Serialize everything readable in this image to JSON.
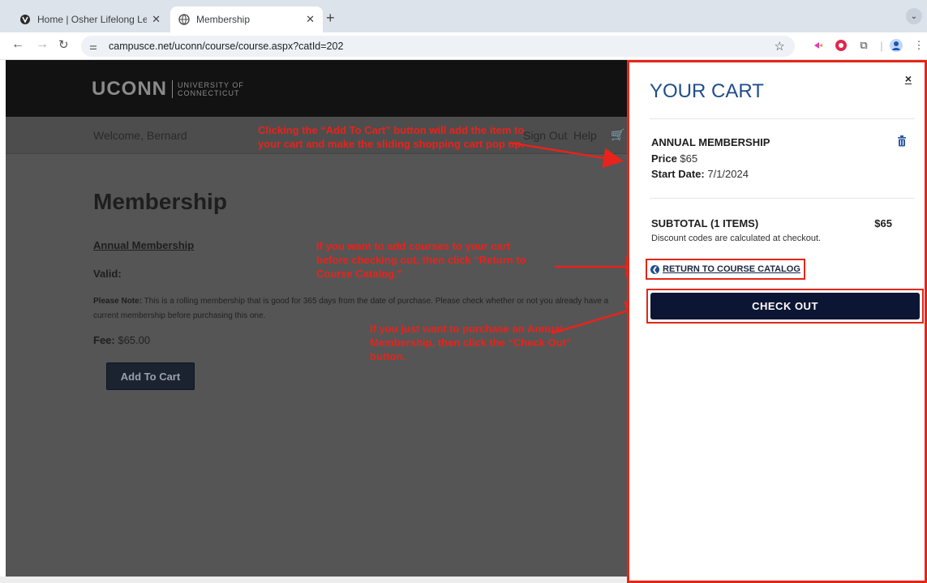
{
  "browser": {
    "tabs": [
      {
        "title": "Home | Osher Lifelong Learnin",
        "icon": "uconn-favicon",
        "active": false
      },
      {
        "title": "Membership",
        "icon": "globe-icon",
        "active": true
      }
    ],
    "url": "campusce.net/uconn/course/course.aspx?catId=202"
  },
  "site": {
    "logo_main": "UCONN",
    "logo_line1": "UNIVERSITY OF",
    "logo_line2": "CONNECTICUT",
    "welcome": "Welcome, Bernard",
    "signout": "Sign Out",
    "help": "Help"
  },
  "course": {
    "title": "Membership",
    "item_link": "Annual Membership",
    "valid_label": "Valid:",
    "note_label": "Please Note:",
    "note_text": " This is a rolling membership that is good for 365 days from the date of purchase. Please check whether or not you already have a current membership before purchasing this one.",
    "fee_label": "Fee:",
    "fee_value": " $65.00",
    "add_to_cart": "Add To Cart"
  },
  "cart": {
    "title": "YOUR CART",
    "close": "×",
    "item_name": "ANNUAL MEMBERSHIP",
    "price_label": "Price",
    "price_value": " $65",
    "start_label": "Start Date:",
    "start_value": " 7/1/2024",
    "subtotal_label": "SUBTOTAL (1 ITEMS)",
    "subtotal_value": "$65",
    "discount_note": "Discount codes are calculated at checkout.",
    "return_link": "RETURN TO COURSE CATALOG",
    "checkout": "CHECK OUT"
  },
  "annotations": {
    "a1": "Clicking the “Add To Cart” button will add the item to your cart and make the sliding shopping cart pop up.",
    "a2": "If you want to add courses to your cart before checking out, then click “Return to Course Catalog.”",
    "a3": "If you just want to purchase an Annual Membership, then click the “Check Out” button."
  },
  "colors": {
    "annotation": "#e8231b",
    "cart_title": "#1f4e8c",
    "checkout_bg": "#0c1634"
  }
}
